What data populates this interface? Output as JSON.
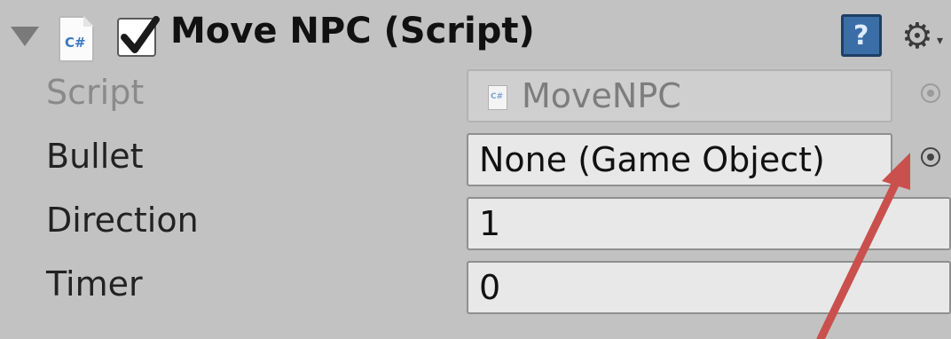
{
  "component": {
    "title": "Move NPC (Script)",
    "enabled": true,
    "icon_glyph": "C#",
    "help_glyph": "?",
    "gear_glyph": "⚙",
    "dropdown_glyph": "▾"
  },
  "fields": [
    {
      "label": "Script",
      "value": "MoveNPC",
      "disabled": true,
      "icon": "csharp-script-icon"
    },
    {
      "label": "Bullet",
      "value": "None (Game Object)",
      "disabled": false
    },
    {
      "label": "Direction",
      "value": "1",
      "disabled": false
    },
    {
      "label": "Timer",
      "value": "0",
      "disabled": false
    }
  ],
  "annotation": {
    "color": "#c9504d"
  }
}
